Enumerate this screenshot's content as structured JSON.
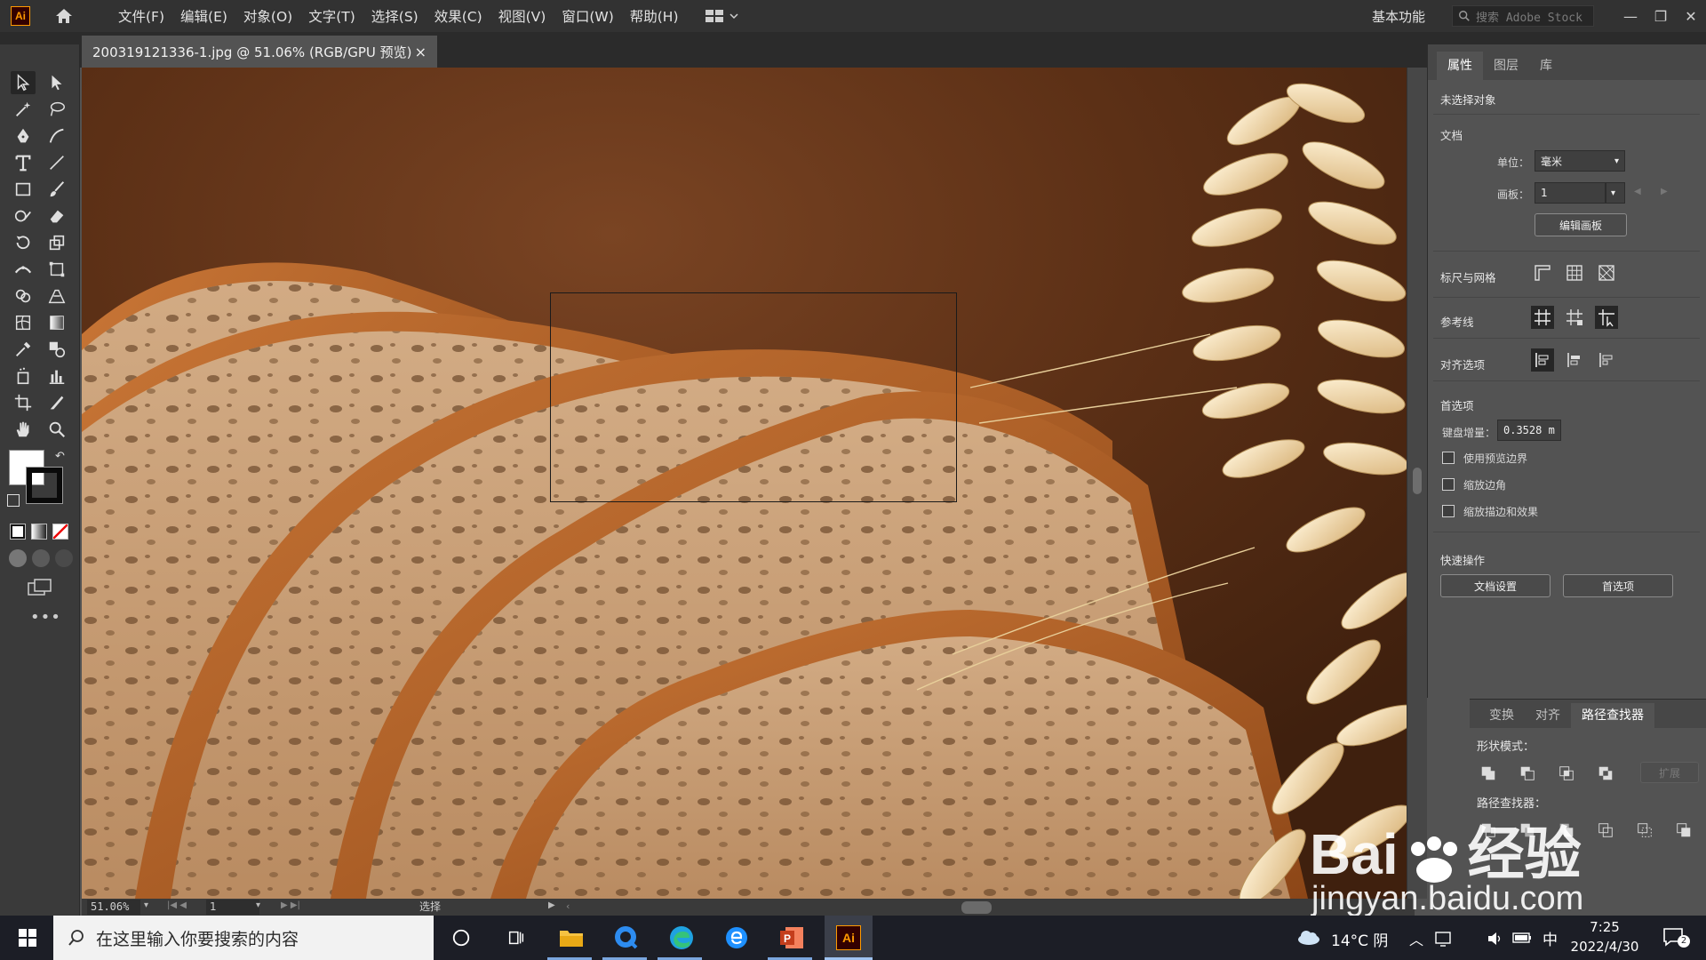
{
  "app": {
    "logo": "Ai",
    "workspace": "基本功能",
    "stock_placeholder": "搜索 Adobe Stock"
  },
  "menu": [
    "文件(F)",
    "编辑(E)",
    "对象(O)",
    "文字(T)",
    "选择(S)",
    "效果(C)",
    "视图(V)",
    "窗口(W)",
    "帮助(H)"
  ],
  "document_tab": {
    "title": "200319121336-1.jpg @ 51.06% (RGB/GPU 预览)",
    "close": "×"
  },
  "properties_panel": {
    "tabs": [
      "属性",
      "图层",
      "库"
    ],
    "active_tab": "属性",
    "no_selection": "未选择对象",
    "document_section": "文档",
    "units_label": "单位：",
    "units_value": "毫米",
    "artboard_label": "画板：",
    "artboard_value": "1",
    "edit_artboards": "编辑画板",
    "rulers_grids": "标尺与网格",
    "guides": "参考线",
    "align_options": "对齐选项",
    "preferences": "首选项",
    "keyboard_increment_label": "键盘增量：",
    "keyboard_increment_value": "0.3528 m",
    "checkbox_preview_bounds": "使用预览边界",
    "checkbox_scale_corners": "缩放边角",
    "checkbox_scale_strokes": "缩放描边和效果",
    "quick_actions": "快速操作",
    "doc_setup": "文档设置",
    "prefs_button": "首选项"
  },
  "pathfinder_panel": {
    "tabs": [
      "变换",
      "对齐",
      "路径查找器"
    ],
    "active_tab": "路径查找器",
    "shape_modes": "形状模式：",
    "pathfinders": "路径查找器：",
    "expand": "扩展"
  },
  "status_bar": {
    "zoom": "51.06%",
    "artboard": "1",
    "tool": "选择"
  },
  "taskbar": {
    "search_placeholder": "在这里输入你要搜索的内容",
    "weather": "14°C 阴",
    "ime": "中",
    "time": "7:25",
    "date": "2022/4/30",
    "notification_count": "2",
    "active_app": "Ai"
  },
  "watermark": {
    "brand": "Bai",
    "brand2": "经验",
    "url": "jingyan.baidu.com"
  },
  "colors": {
    "accent_ai": "#ff9a00",
    "panel_bg": "#535353",
    "menubar_bg": "#323232"
  }
}
